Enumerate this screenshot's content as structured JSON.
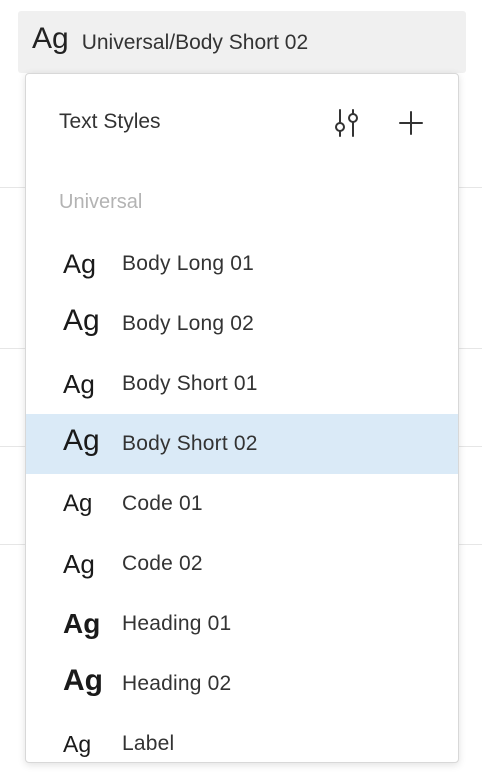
{
  "trigger": {
    "preview": "Ag",
    "label": "Universal/Body Short 02"
  },
  "panel": {
    "title": "Text Styles",
    "section": "Universal",
    "icons": {
      "settings": "sliders-icon",
      "add": "plus-icon"
    },
    "items": [
      {
        "preview": "Ag",
        "label": "Body Long 01",
        "selected": false
      },
      {
        "preview": "Ag",
        "label": "Body Long 02",
        "selected": false
      },
      {
        "preview": "Ag",
        "label": "Body Short 01",
        "selected": false
      },
      {
        "preview": "Ag",
        "label": "Body Short 02",
        "selected": true
      },
      {
        "preview": "Ag",
        "label": "Code 01",
        "selected": false
      },
      {
        "preview": "Ag",
        "label": "Code 02",
        "selected": false
      },
      {
        "preview": "Ag",
        "label": "Heading 01",
        "selected": false
      },
      {
        "preview": "Ag",
        "label": "Heading 02",
        "selected": false
      },
      {
        "preview": "Ag",
        "label": "Label",
        "selected": false
      }
    ]
  },
  "colors": {
    "selected_bg": "#daeaf7",
    "trigger_bg": "#f0f0f0",
    "section_label": "#b3b3b3"
  }
}
